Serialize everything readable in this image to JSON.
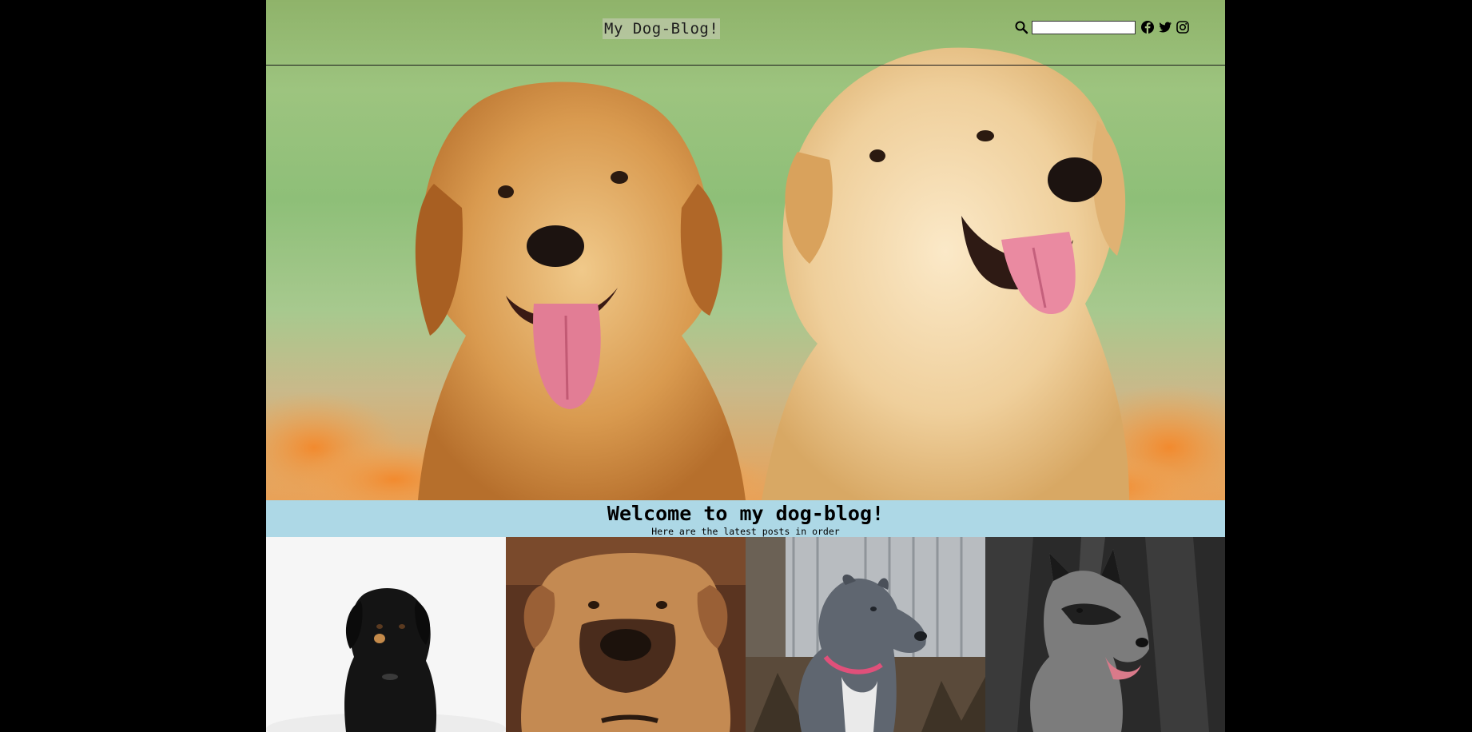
{
  "header": {
    "site_title": "My Dog-Blog!",
    "search_input_value": "",
    "icons": [
      "search-icon",
      "facebook-icon",
      "twitter-icon",
      "instagram-icon"
    ]
  },
  "hero": {
    "image": "two-golden-retriever-puppies"
  },
  "welcome": {
    "title": "Welcome to my dog-blog!",
    "subtitle": "Here are the latest posts in order"
  },
  "posts": [
    {
      "image": "black-labrador"
    },
    {
      "image": "boerboel-mastiff"
    },
    {
      "image": "grey-pitbull"
    },
    {
      "image": "german-shepherd"
    }
  ],
  "colors": {
    "page_background": "#000000",
    "welcome_band": "#add8e6",
    "header_rule": "#1a1a1a"
  }
}
